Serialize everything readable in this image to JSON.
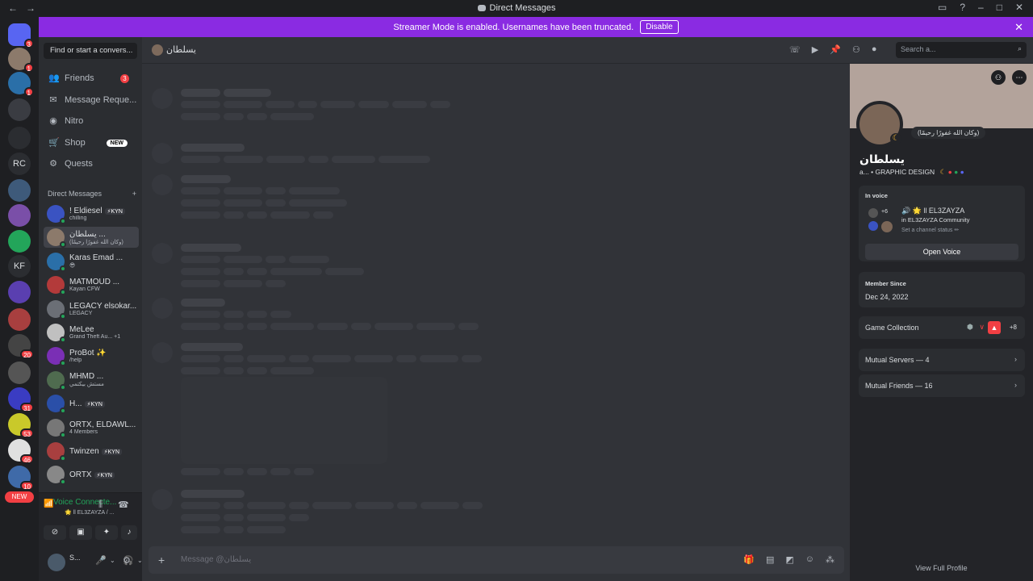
{
  "window": {
    "title": "Direct Messages",
    "back": "←",
    "forward": "→"
  },
  "banner": {
    "text": "Streamer Mode is enabled. Usernames have been truncated.",
    "disable_label": "Disable"
  },
  "servers": [
    {
      "label": "",
      "badge": "3",
      "color": "#5865f2"
    },
    {
      "label": "",
      "badge": "1",
      "color": "#8c7a6b"
    },
    {
      "label": "",
      "badge": "1",
      "color": "#2a6fa8"
    },
    {
      "label": "",
      "badge": "",
      "color": "#3a3c42"
    },
    {
      "label": "",
      "badge": "",
      "color": "#2b2d31"
    },
    {
      "label": "RC",
      "badge": "",
      "color": "#2b2d31"
    },
    {
      "label": "",
      "badge": "",
      "color": "#3e5a7a"
    },
    {
      "label": "",
      "badge": "",
      "color": "#7a4fa8"
    },
    {
      "label": "",
      "badge": "",
      "color": "#23a55a"
    },
    {
      "label": "KF",
      "badge": "",
      "color": "#2b2d31"
    },
    {
      "label": "",
      "badge": "",
      "color": "#5a3fb0"
    },
    {
      "label": "",
      "badge": "",
      "color": "#a83f3f"
    },
    {
      "label": "",
      "badge": "20",
      "color": "#444"
    },
    {
      "label": "",
      "badge": "",
      "color": "#555"
    },
    {
      "label": "",
      "badge": "31",
      "color": "#3a3cc2"
    },
    {
      "label": "",
      "badge": "53",
      "color": "#c9c92a"
    },
    {
      "label": "",
      "badge": "46",
      "color": "#e0e0e0"
    },
    {
      "label": "",
      "badge": "10",
      "color": "#3f6aa8"
    }
  ],
  "server_new_label": "NEW",
  "sidebar": {
    "find_placeholder": "Find or start a convers...",
    "nav": [
      {
        "label": "Friends",
        "badge": "3",
        "tag": ""
      },
      {
        "label": "Message Reque...",
        "badge": "",
        "tag": ""
      },
      {
        "label": "Nitro",
        "badge": "",
        "tag": ""
      },
      {
        "label": "Shop",
        "badge": "",
        "tag": "NEW"
      },
      {
        "label": "Quests",
        "badge": "",
        "tag": ""
      }
    ],
    "dm_header": "Direct Messages",
    "dm_add": "+",
    "dms": [
      {
        "name": "! Eldiesel",
        "tag": "⚡KYN",
        "sub": "chilling",
        "color": "#3a53c2"
      },
      {
        "name": "يسلطان ...",
        "tag": "",
        "sub": "(وكان الله غفورًا رحيمًا)",
        "color": "#8c7a6b"
      },
      {
        "name": "Karas Emad ...",
        "tag": "",
        "sub": "😎",
        "color": "#2a6fa8"
      },
      {
        "name": "MATMOUD ...",
        "tag": "",
        "sub": "Kayan CFW",
        "color": "#b33a3a"
      },
      {
        "name": "LEGACY elsokar...",
        "tag": "",
        "sub": "LEGACY",
        "color": "#6b6f76"
      },
      {
        "name": "MeLee",
        "tag": "",
        "sub": "Grand Theft Au... +1",
        "color": "#c0c0c0"
      },
      {
        "name": "ProBot ✨",
        "tag": "",
        "sub": "/help",
        "color": "#7a2fb5"
      },
      {
        "name": "MHMD ...",
        "tag": "",
        "sub": "مستش بيكتمي",
        "color": "#4f6b4f"
      },
      {
        "name": "H...",
        "tag": "⚡KYN",
        "sub": "",
        "color": "#2a4fa8"
      },
      {
        "name": "ORTX, ELDAWL...",
        "tag": "",
        "sub": "4 Members",
        "color": "#777"
      },
      {
        "name": "Twinzen",
        "tag": "⚡KYN",
        "sub": "",
        "color": "#a83f3f"
      },
      {
        "name": "ORTX",
        "tag": "⚡KYN",
        "sub": "",
        "color": "#888"
      }
    ]
  },
  "voice_panel": {
    "title": "Voice Connecte...",
    "sub": "🌟 ll EL3ZAYZA / ..."
  },
  "user_panel": {
    "name": "S..."
  },
  "chat": {
    "header_name": "يسلطان",
    "search_placeholder": "Search a...",
    "message_placeholder": "Message @يسلطان"
  },
  "profile": {
    "bubble": "(وكان الله غفورًا رحيمًا)",
    "display_name": "يسلطان",
    "subline": "a... • GRAPHIC DESIGN",
    "in_voice_label": "In voice",
    "voice_channel": "🔊 🌟 ll EL3ZAYZA",
    "voice_server": "in EL3ZAYZA Community",
    "voice_status": "Set a channel status ✏",
    "voice_count": "+6",
    "open_voice": "Open Voice",
    "member_since_label": "Member Since",
    "member_since": "Dec 24, 2022",
    "game_collection": "Game Collection",
    "game_more": "+8",
    "mutual_servers": "Mutual Servers — 4",
    "mutual_friends": "Mutual Friends — 16",
    "view_full": "View Full Profile"
  },
  "colors": {
    "banner": "#8a2be2",
    "online": "#23a55a",
    "badge": "#f23f43"
  }
}
